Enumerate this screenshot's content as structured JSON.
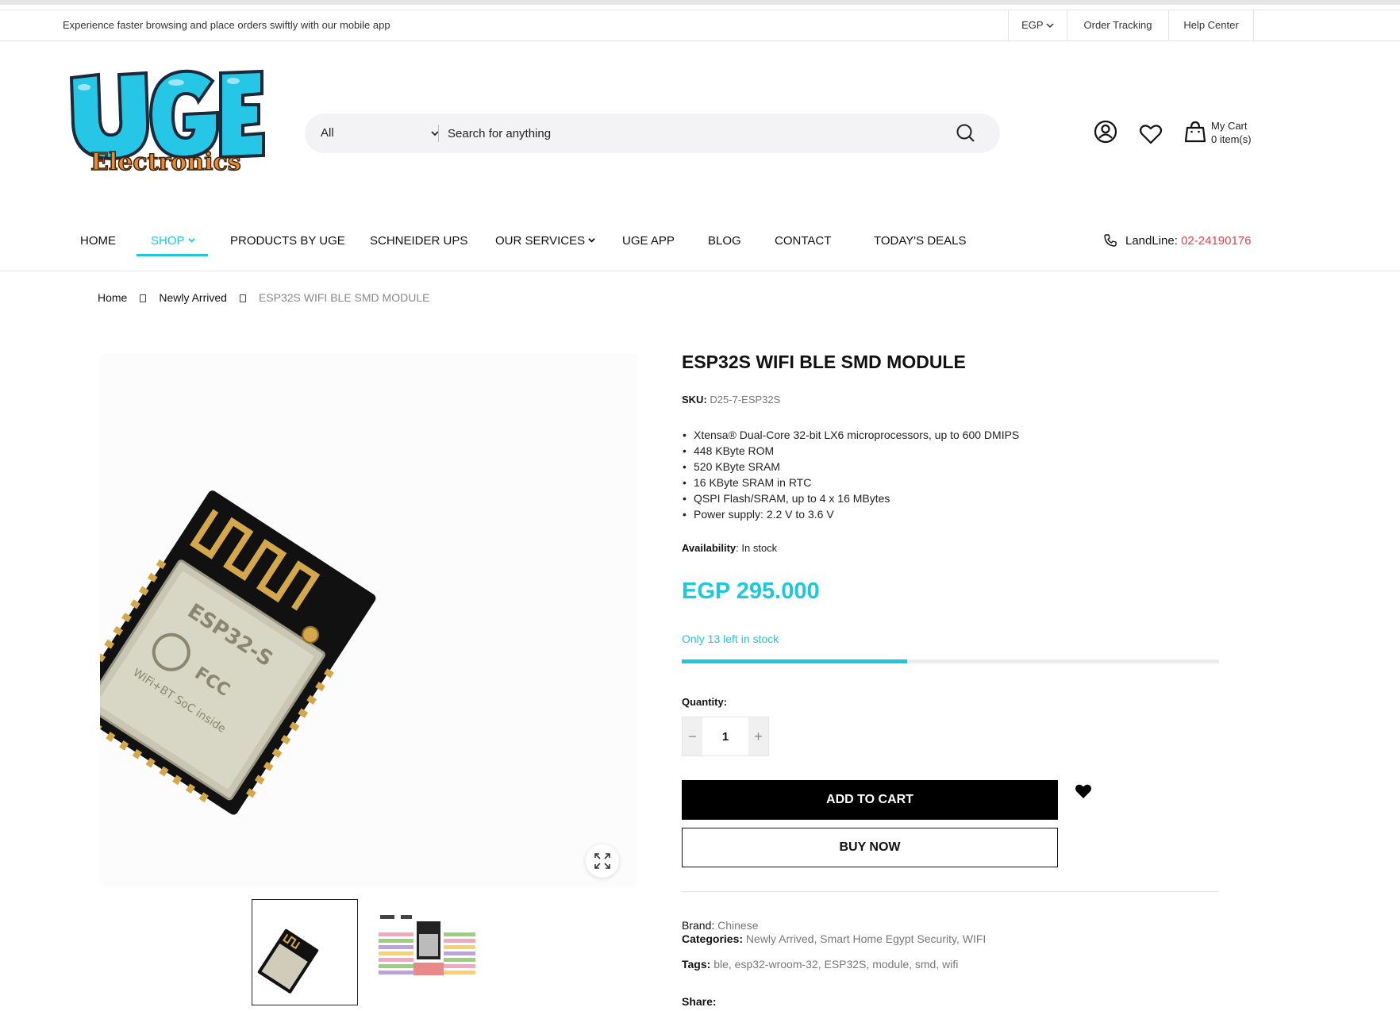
{
  "topbar": {
    "promo": "Experience faster browsing and place orders swiftly with our mobile app",
    "currency": "EGP",
    "order_tracking": "Order Tracking",
    "help_center": "Help Center"
  },
  "logo": {
    "line1": "UGE",
    "line2": "Electronics"
  },
  "search": {
    "category": "All",
    "placeholder": "Search for anything"
  },
  "header": {
    "cart_label": "My Cart",
    "cart_count": "0 item(s)"
  },
  "nav": {
    "items": [
      "HOME",
      "SHOP",
      "PRODUCTS BY UGE",
      "SCHNEIDER UPS",
      "OUR SERVICES",
      "UGE APP",
      "BLOG",
      "CONTACT",
      "TODAY'S DEALS"
    ],
    "landline_label": "LandLine:",
    "landline_number": "02-24190176"
  },
  "breadcrumb": [
    "Home",
    "Newly Arrived",
    "ESP32S WIFI BLE SMD MODULE"
  ],
  "product": {
    "title": "ESP32S WIFI BLE SMD MODULE",
    "sku_label": "SKU:",
    "sku": "D25-7-ESP32S",
    "features": [
      "Xtensa® Dual-Core 32-bit LX6 microprocessors, up to 600 DMIPS",
      "448 KByte ROM",
      "520 KByte SRAM",
      "16 KByte SRAM in RTC",
      "QSPI Flash/SRAM, up to 4 x 16 MBytes",
      "Power supply: 2.2 V to 3.6 V"
    ],
    "availability_label": "Availability",
    "availability": ": In stock",
    "price": "EGP 295.000",
    "stock_text": "Only 13 left in stock",
    "stock_fraction": 0.42,
    "quantity_label": "Quantity:",
    "quantity": "1",
    "add_to_cart": "ADD TO CART",
    "buy_now": "BUY NOW",
    "brand_label": "Brand:",
    "brand": "Chinese",
    "categories_label": "Categories:",
    "categories": "Newly Arrived, Smart Home Egypt Security, WIFI",
    "tags_label": "Tags:",
    "tags": "ble, esp32-wroom-32, ESP32S, module, smd, wifi",
    "share_label": "Share:"
  },
  "colors": {
    "accent": "#1ec8dc",
    "landline": "#e8404a",
    "logo_blue": "#26c6e6",
    "logo_orange": "#f08a24"
  }
}
